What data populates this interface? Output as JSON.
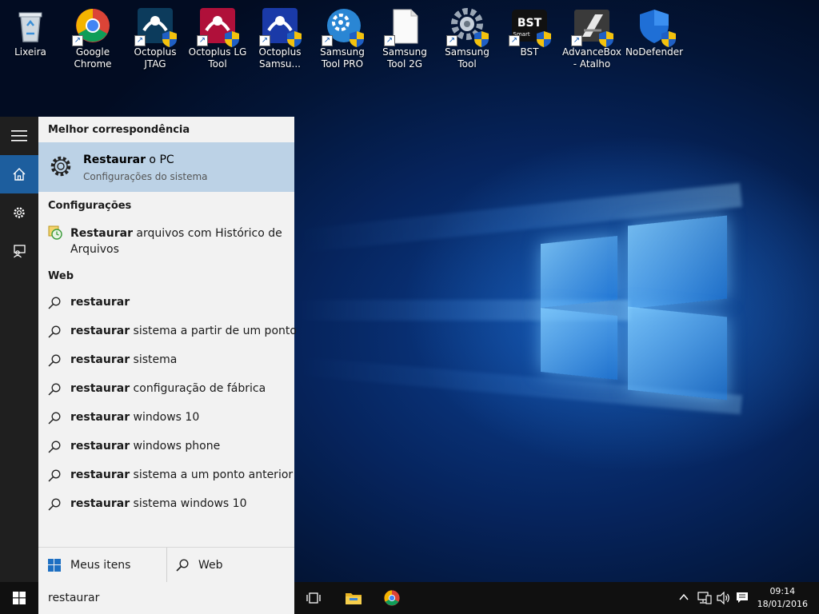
{
  "desktop": {
    "icons": [
      {
        "label": "Lixeira",
        "icon": "recycle-bin-icon"
      },
      {
        "label": "Google Chrome",
        "icon": "chrome-icon"
      },
      {
        "label": "Octoplus JTAG",
        "icon": "octoplus-jtag-icon"
      },
      {
        "label": "Octoplus LG Tool",
        "icon": "octoplus-lg-icon"
      },
      {
        "label": "Octoplus Samsu...",
        "icon": "octoplus-samsung-icon"
      },
      {
        "label": "Samsung Tool PRO",
        "icon": "samsung-tool-pro-icon"
      },
      {
        "label": "Samsung Tool 2G",
        "icon": "samsung-tool-2g-icon"
      },
      {
        "label": "Samsung Tool",
        "icon": "samsung-tool-icon"
      },
      {
        "label": "BST",
        "icon": "bst-icon"
      },
      {
        "label": "AdvanceBox - Atalho",
        "icon": "advancebox-icon"
      },
      {
        "label": "NoDefender",
        "icon": "nodefender-icon"
      }
    ],
    "bst_logo_text": "BST",
    "bst_logo_sub": "Smart"
  },
  "search": {
    "best_match_header": "Melhor correspondência",
    "best_match": {
      "title_bold": "Restaurar",
      "title_rest": " o PC",
      "subtitle": "Configurações do sistema"
    },
    "settings_header": "Configurações",
    "settings_result": {
      "bold": "Restaurar",
      "rest": " arquivos com Histórico de",
      "line2": "Arquivos"
    },
    "web_header": "Web",
    "web_results": [
      {
        "bold": "restaurar",
        "rest": ""
      },
      {
        "bold": "restaurar",
        "rest": " sistema a partir de um ponto"
      },
      {
        "bold": "restaurar",
        "rest": " sistema"
      },
      {
        "bold": "restaurar",
        "rest": " configuração de fábrica"
      },
      {
        "bold": "restaurar",
        "rest": " windows 10"
      },
      {
        "bold": "restaurar",
        "rest": " windows phone"
      },
      {
        "bold": "restaurar",
        "rest": " sistema a um ponto anterior"
      },
      {
        "bold": "restaurar",
        "rest": " sistema windows 10"
      }
    ],
    "filters": {
      "my_stuff": "Meus itens",
      "web": "Web"
    },
    "query": "restaurar"
  },
  "taskbar": {
    "clock_time": "09:14",
    "clock_date": "18/01/2016"
  },
  "colors": {
    "accent": "#1d5e9e",
    "best_match_bg": "#bcd2e6",
    "panel_bg": "#f2f2f2",
    "rail_bg": "#1f1f1f",
    "taskbar_bg": "#101010"
  }
}
